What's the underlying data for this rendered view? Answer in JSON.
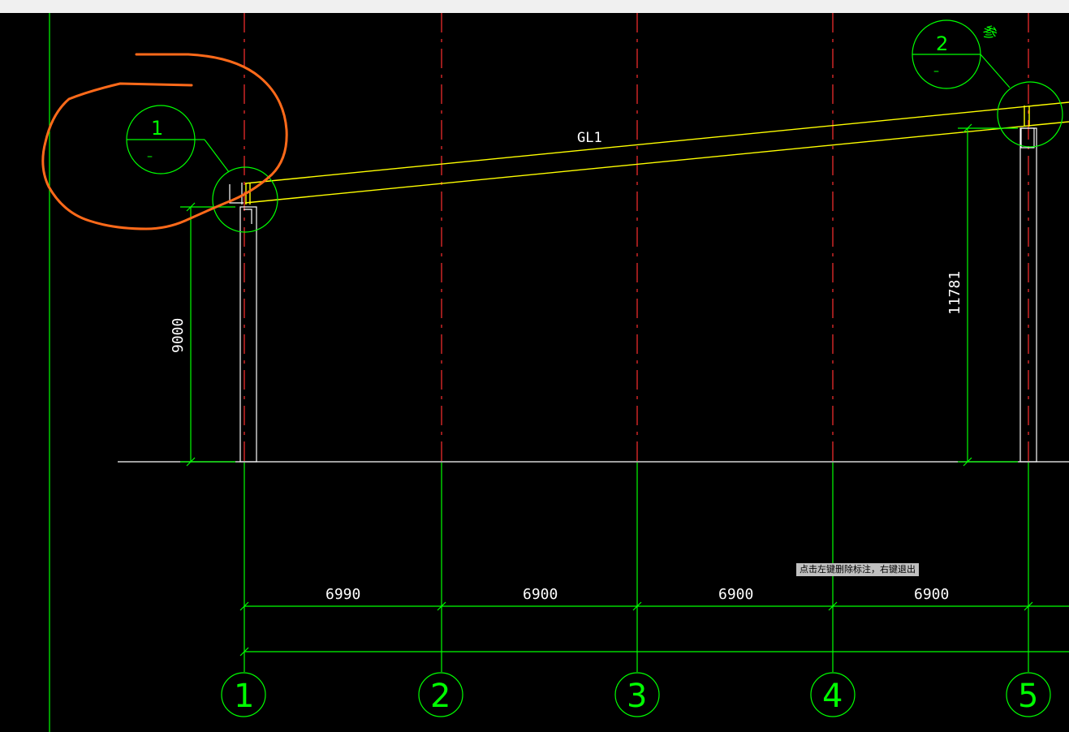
{
  "beam_label": "GL1",
  "dims": {
    "left_height": "9000",
    "right_height": "11781",
    "spans": [
      "6990",
      "6900",
      "6900",
      "6900"
    ]
  },
  "axes": [
    "1",
    "2",
    "3",
    "4",
    "5"
  ],
  "details": [
    {
      "num": "1",
      "dash": "–"
    },
    {
      "num": "2",
      "dash": "–"
    }
  ],
  "ref_char": "参",
  "status_tip": "点击左键删除标注，右键退出",
  "colors": {
    "background": "#000000",
    "axis_lines": "#00ff00",
    "center_lines": "#ff3030",
    "beam": "#ffff00",
    "annotation": "#ff6a1a"
  }
}
